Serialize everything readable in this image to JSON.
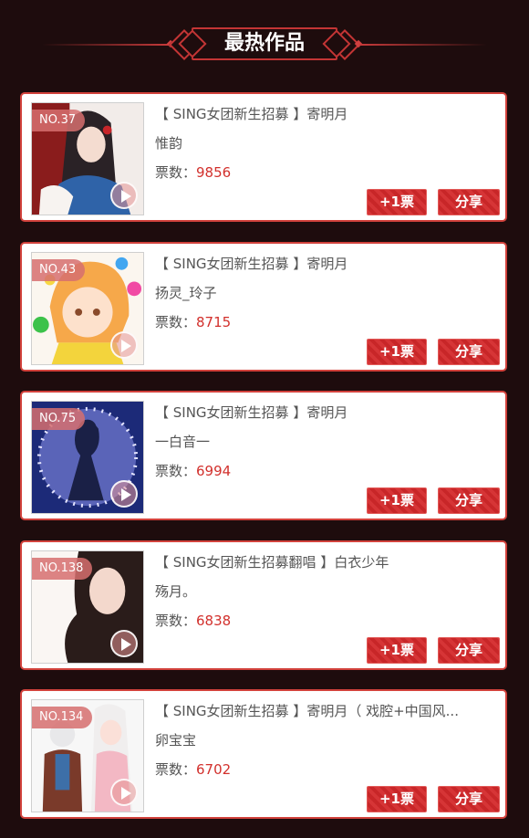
{
  "header": {
    "title": "最热作品"
  },
  "colors": {
    "background": "#1e0c0d",
    "accent": "#d2423c",
    "button": "#d3282a",
    "vote_number": "#d2302c"
  },
  "labels": {
    "votes_prefix": "票数：",
    "vote_button": "+1票",
    "share_button": "分享"
  },
  "works": [
    {
      "rank": "NO.37",
      "title": "【 SING女团新生招募 】寄明月",
      "singer": "惟韵",
      "votes": "9856"
    },
    {
      "rank": "NO.43",
      "title": "【 SING女团新生招募 】寄明月",
      "singer": "扬灵_玲子",
      "votes": "8715"
    },
    {
      "rank": "NO.75",
      "title": "【 SING女团新生招募 】寄明月",
      "singer": "一白音一",
      "votes": "6994"
    },
    {
      "rank": "NO.138",
      "title": "【 SING女团新生招募翻唱 】白衣少年",
      "singer": "殇月。",
      "votes": "6838"
    },
    {
      "rank": "NO.134",
      "title": "【 SING女团新生招募 】寄明月（ 戏腔+中国风...",
      "singer": "卵宝宝",
      "votes": "6702"
    }
  ]
}
